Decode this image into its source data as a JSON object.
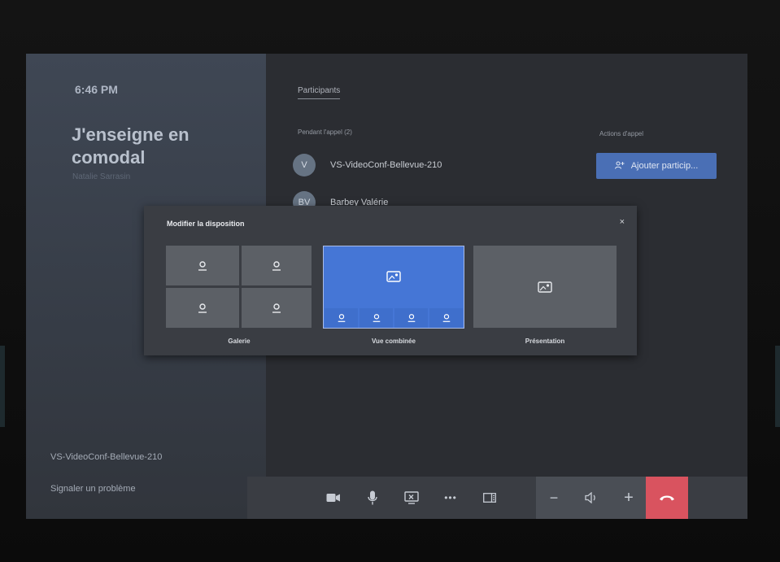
{
  "left_panel": {
    "time": "6:46 PM",
    "meeting_title": "J'enseigne en comodal",
    "organizer": "Natalie Sarrasin",
    "room": "VS-VideoConf-Bellevue-210",
    "report_problem": "Signaler un problème"
  },
  "participants_panel": {
    "tab_label": "Participants",
    "in_call_header": "Pendant l'appel (2)",
    "actions_header": "Actions d'appel",
    "add_button": "Ajouter particip...",
    "participants": [
      {
        "initials": "V",
        "name": "VS-VideoConf-Bellevue-210"
      },
      {
        "initials": "BV",
        "name": "Barbey Valérie"
      }
    ]
  },
  "layout_dialog": {
    "title": "Modifier la disposition",
    "close": "×",
    "options": [
      {
        "label": "Galerie",
        "selected": false
      },
      {
        "label": "Vue combinée",
        "selected": true
      },
      {
        "label": "Présentation",
        "selected": false
      }
    ]
  },
  "control_bar": {
    "buttons": [
      "camera-icon",
      "microphone-icon",
      "share-screen-icon",
      "more-icon",
      "layout-icon",
      "volume-down-icon",
      "speaker-icon",
      "volume-up-icon",
      "hang-up-icon"
    ],
    "more_label": "•••",
    "minus_label": "−",
    "plus_label": "+"
  },
  "colors": {
    "accent": "#4576d6",
    "add_button": "#4a6fb5",
    "hangup": "#d9535f"
  }
}
